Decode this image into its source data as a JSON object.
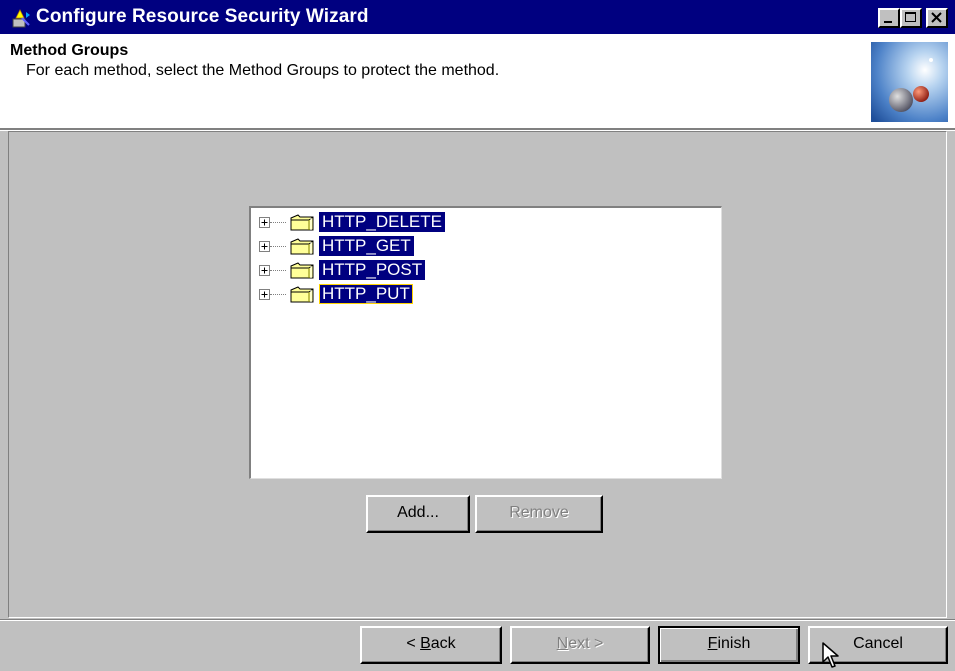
{
  "window": {
    "title": "Configure Resource Security Wizard"
  },
  "header": {
    "title": "Method Groups",
    "subtitle": "For each method, select the Method Groups to protect the method."
  },
  "tree": {
    "items": [
      {
        "label": "HTTP_DELETE",
        "selected": true
      },
      {
        "label": "HTTP_GET",
        "selected": true
      },
      {
        "label": "HTTP_POST",
        "selected": true
      },
      {
        "label": "HTTP_PUT",
        "selected": true,
        "focused": true
      }
    ]
  },
  "buttons": {
    "add": "Add...",
    "remove": "Remove",
    "back_prefix": "< ",
    "back_mnemonic": "B",
    "back_rest": "ack",
    "next_mnemonic": "N",
    "next_rest": "ext >",
    "finish_mnemonic": "F",
    "finish_rest": "inish",
    "cancel": "Cancel"
  },
  "colors": {
    "titlebar": "#000080",
    "selection": "#000080",
    "face": "#c0c0c0",
    "focus_outline": "#ffd400"
  },
  "icons": {
    "window": "wizard-icon",
    "minimize": "minimize-icon",
    "maximize": "maximize-icon",
    "close": "close-icon",
    "expander": "plus-expander-icon",
    "folder": "folder-icon",
    "header_image": "globe-graphic",
    "cursor": "mouse-pointer-icon"
  }
}
